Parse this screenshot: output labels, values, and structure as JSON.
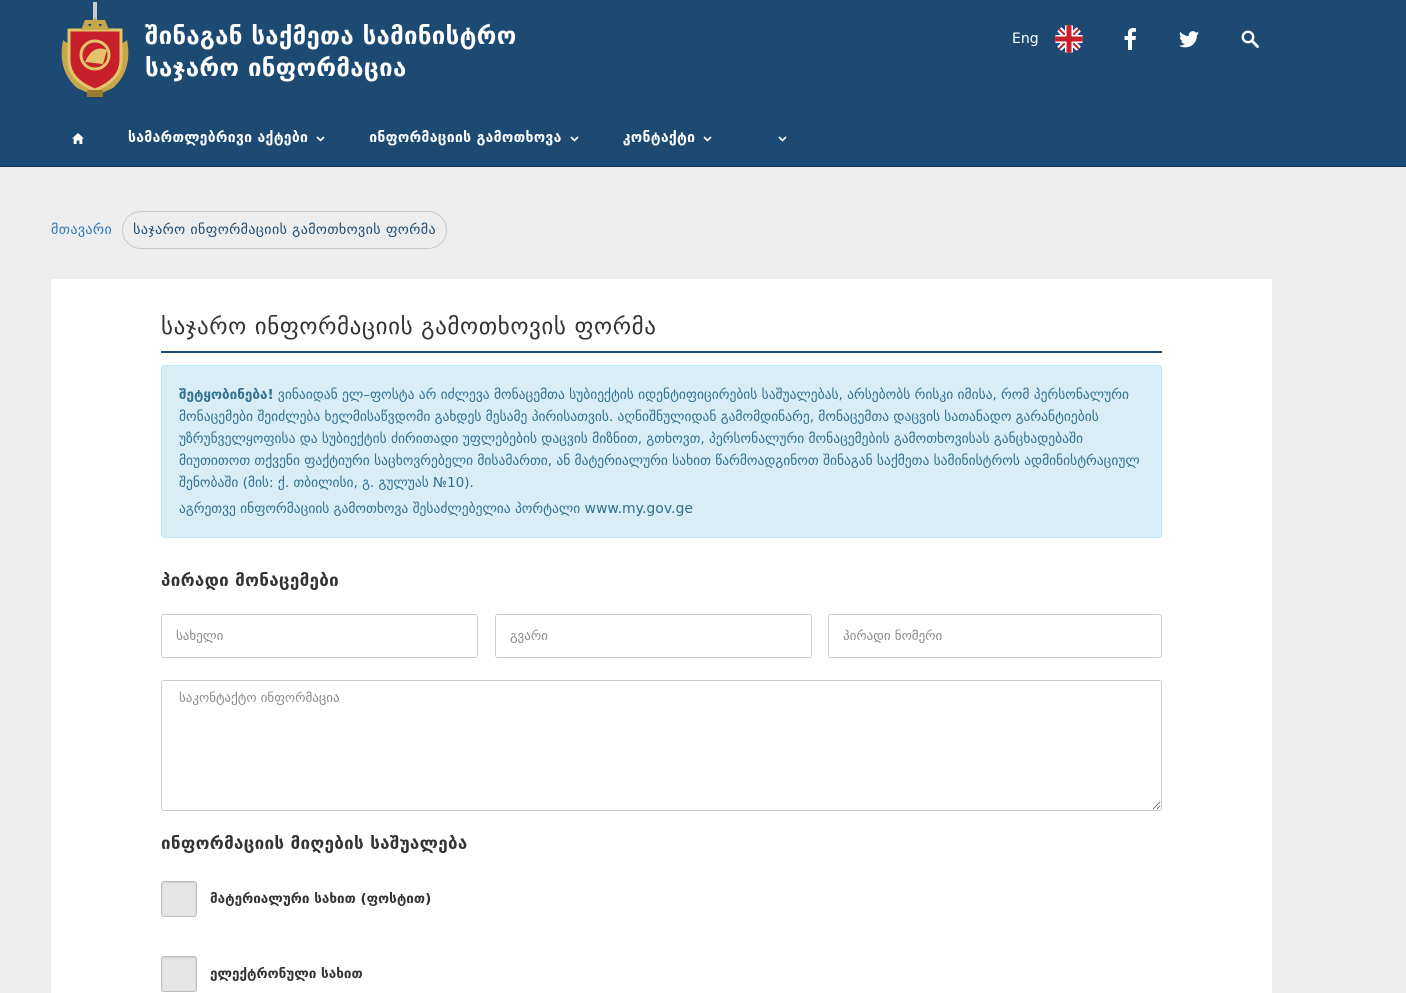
{
  "header": {
    "title_line1": "შინაგან საქმეთა სამინისტრო",
    "title_line2": "საჯარო ინფორმაცია",
    "lang_label": "Eng",
    "icons": [
      "uk-flag-icon",
      "facebook-icon",
      "twitter-icon",
      "search-icon"
    ]
  },
  "nav": {
    "items": [
      {
        "label": "სამართლებრივი აქტები"
      },
      {
        "label": "ინფორმაციის გამოთხოვა"
      },
      {
        "label": "კონტაქტი"
      },
      {
        "label": ""
      }
    ]
  },
  "breadcrumb": {
    "home": "მთავარი",
    "current": "საჯარო ინფორმაციის გამოთხოვის ფორმა"
  },
  "form": {
    "title": "საჯარო ინფორმაციის გამოთხოვის ფორმა",
    "notice_bold": "შეტყობინება!",
    "notice_text": "ვინაიდან ელ–ფოსტა არ იძლევა მონაცემთა სუბიექტის იდენტიფიცირების საშუალებას, არსებობს რისკი იმისა, რომ პერსონალური მონაცემები შეიძლება ხელმისაწვდომი გახდეს მესამე პირისათვის. აღნიშნულიდან გამომდინარე, მონაცემთა დაცვის სათანადო გარანტიების უზრუნველყოფისა და სუბიექტის ძირითადი უფლებების დაცვის მიზნით, გთხოვთ, პერსონალური მონაცემების გამოთხოვისას განცხადებაში მიუთითოთ თქვენი ფაქტიური საცხოვრებელი მისამართი, ან მატერიალური სახით წარმოადგინოთ შინაგან საქმეთა სამინისტროს ადმინისტრაციულ შენობაში (მის: ქ. თბილისი, გ. გულუას №10).",
    "portal_text": "აგრეთვე ინფორმაციის გამოთხოვა შესაძლებელია პორტალი",
    "portal_link": "www.my.gov.ge",
    "personal_title": "პირადი მონაცემები",
    "name_placeholder": "სახელი",
    "surname_placeholder": "გვარი",
    "personal_number_placeholder": "პირადი ნომერი",
    "contact_placeholder": "საკონტაქტო ინფორმაცია",
    "receive_title": "ინფორმაციის მიღების საშუალება",
    "option_material": "მატერიალური სახით (ფოსტით)",
    "option_electronic": "ელექტრონული სახით"
  },
  "colors": {
    "header_bg": "#1d4a72",
    "page_bg": "#ededed",
    "alert_bg": "#d9edf7",
    "alert_text": "#31708f",
    "link": "#2c78b4"
  }
}
